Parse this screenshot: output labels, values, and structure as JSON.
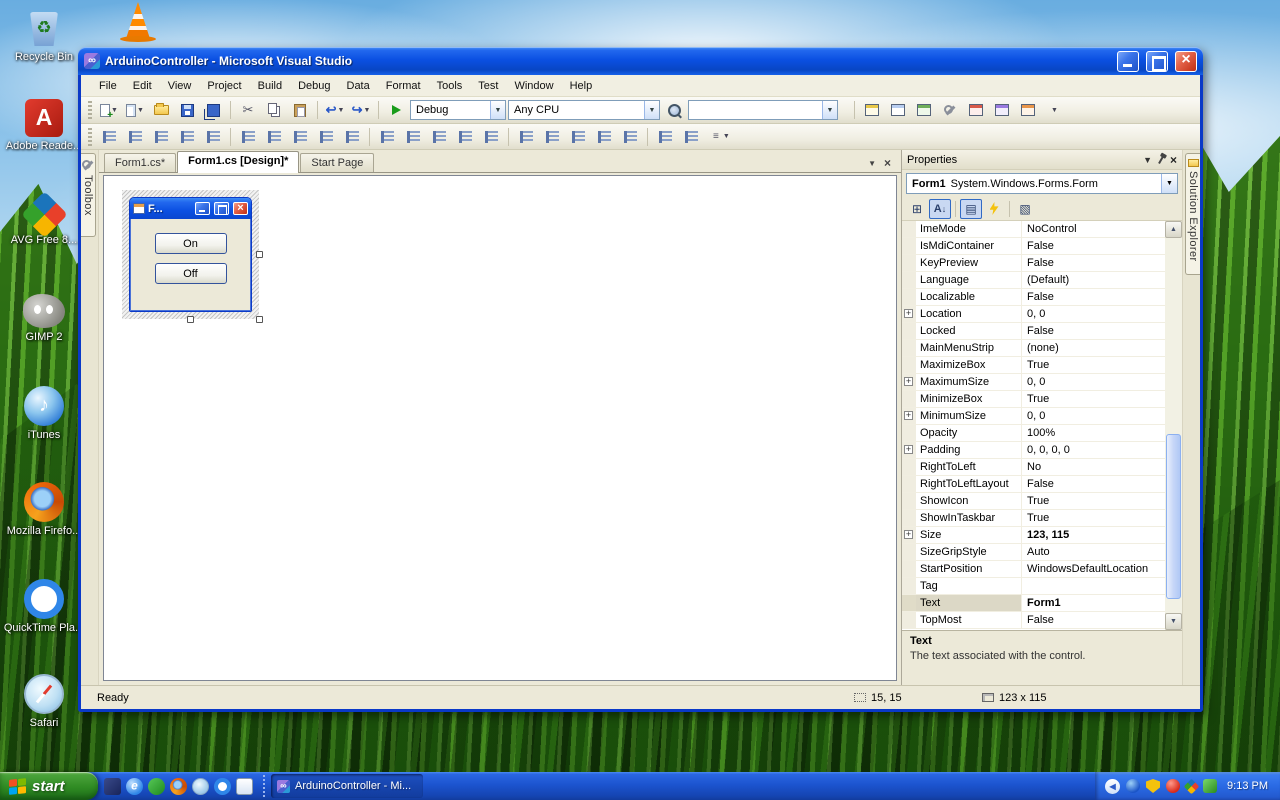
{
  "desktop": {
    "icons": [
      {
        "kind": "recycle-bin",
        "label": "Recycle Bin"
      },
      {
        "kind": "adobe-reader",
        "label": "Adobe Reade..."
      },
      {
        "kind": "avg-free",
        "label": "AVG Free 8..."
      },
      {
        "kind": "gimp",
        "label": "GIMP 2"
      },
      {
        "kind": "itunes",
        "label": "iTunes"
      },
      {
        "kind": "firefox",
        "label": "Mozilla Firefo..."
      },
      {
        "kind": "quicktime",
        "label": "QuickTime Pla..."
      },
      {
        "kind": "safari",
        "label": "Safari"
      }
    ]
  },
  "window": {
    "title": "ArduinoController - Microsoft Visual Studio",
    "menus": [
      "File",
      "Edit",
      "View",
      "Project",
      "Build",
      "Debug",
      "Data",
      "Format",
      "Tools",
      "Test",
      "Window",
      "Help"
    ],
    "toolbar": {
      "configuration": "Debug",
      "platform": "Any CPU"
    },
    "tabs": [
      {
        "label": "Form1.cs*"
      },
      {
        "label": "Form1.cs [Design]*"
      },
      {
        "label": "Start Page"
      }
    ],
    "toolbox_label": "Toolbox",
    "solution_explorer_label": "Solution Explorer"
  },
  "designer": {
    "form_title": "F...",
    "button_on": "On",
    "button_off": "Off"
  },
  "properties": {
    "panel_title": "Properties",
    "object_name": "Form1",
    "object_type": "System.Windows.Forms.Form",
    "rows": [
      {
        "name": "ImeMode",
        "value": "NoControl"
      },
      {
        "name": "IsMdiContainer",
        "value": "False"
      },
      {
        "name": "KeyPreview",
        "value": "False"
      },
      {
        "name": "Language",
        "value": "(Default)"
      },
      {
        "name": "Localizable",
        "value": "False"
      },
      {
        "name": "Location",
        "value": "0, 0",
        "expand": true
      },
      {
        "name": "Locked",
        "value": "False"
      },
      {
        "name": "MainMenuStrip",
        "value": "(none)"
      },
      {
        "name": "MaximizeBox",
        "value": "True"
      },
      {
        "name": "MaximumSize",
        "value": "0, 0",
        "expand": true
      },
      {
        "name": "MinimizeBox",
        "value": "True"
      },
      {
        "name": "MinimumSize",
        "value": "0, 0",
        "expand": true
      },
      {
        "name": "Opacity",
        "value": "100%"
      },
      {
        "name": "Padding",
        "value": "0, 0, 0, 0",
        "expand": true
      },
      {
        "name": "RightToLeft",
        "value": "No"
      },
      {
        "name": "RightToLeftLayout",
        "value": "False"
      },
      {
        "name": "ShowIcon",
        "value": "True"
      },
      {
        "name": "ShowInTaskbar",
        "value": "True"
      },
      {
        "name": "Size",
        "value": "123, 115",
        "expand": true,
        "bold": true
      },
      {
        "name": "SizeGripStyle",
        "value": "Auto"
      },
      {
        "name": "StartPosition",
        "value": "WindowsDefaultLocation"
      },
      {
        "name": "Tag",
        "value": ""
      },
      {
        "name": "Text",
        "value": "Form1",
        "bold": true,
        "selected": true
      },
      {
        "name": "TopMost",
        "value": "False"
      }
    ],
    "description_title": "Text",
    "description_text": "The text associated with the control."
  },
  "status": {
    "ready": "Ready",
    "position": "15, 15",
    "size": "123 x 115"
  },
  "taskbar": {
    "start_label": "start",
    "task_label": "ArduinoController - Mi...",
    "time": "9:13 PM"
  }
}
